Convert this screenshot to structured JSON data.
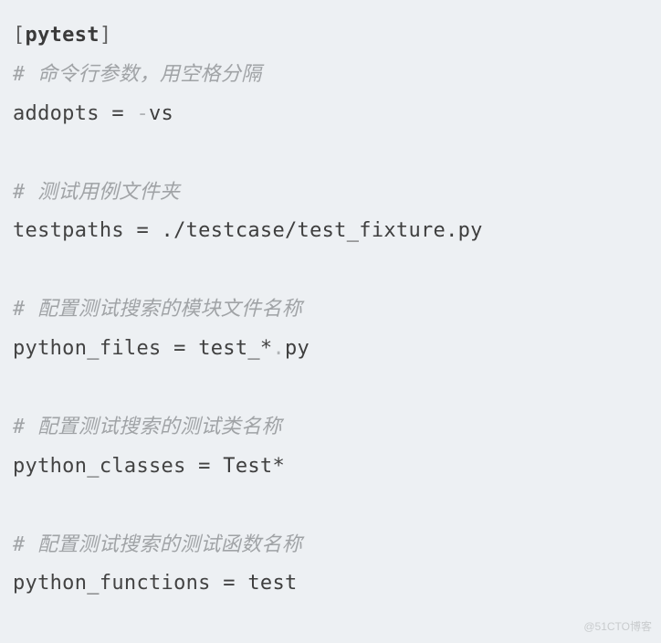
{
  "section": {
    "bracket_open": "[",
    "name": "pytest",
    "bracket_close": "]"
  },
  "blocks": [
    {
      "comment": "# 命令行参数，用空格分隔",
      "key": "addopts",
      "eq": " = ",
      "dash": "-",
      "value": "vs"
    },
    {
      "comment": "# 测试用例文件夹",
      "key": "testpaths",
      "eq": " = ",
      "value": "./testcase/test_fixture.py"
    },
    {
      "comment": "# 配置测试搜索的模块文件名称",
      "key": "python_files",
      "eq": " = ",
      "value": "test_",
      "star": "*",
      "dot": ".",
      "tail": "py"
    },
    {
      "comment": "# 配置测试搜索的测试类名称",
      "key": "python_classes",
      "eq": " = ",
      "value": "Test",
      "star": "*"
    },
    {
      "comment": "# 配置测试搜索的测试函数名称",
      "key": "python_functions",
      "eq": " = ",
      "value": "test"
    }
  ],
  "watermark": "@51CTO博客"
}
